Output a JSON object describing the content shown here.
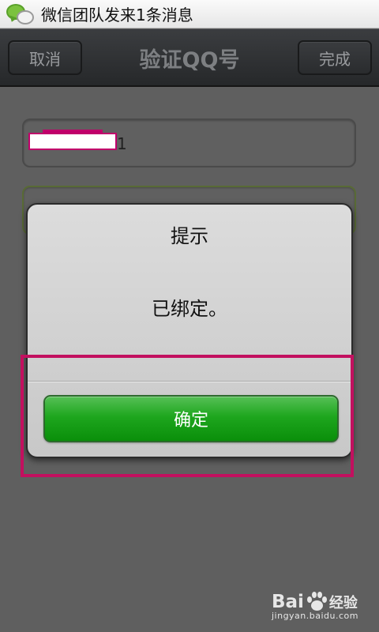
{
  "status_bar": {
    "notification_text": "微信团队发来1条消息",
    "app_icon": "wechat-icon"
  },
  "title_bar": {
    "cancel_label": "取消",
    "title": "验证QQ号",
    "done_label": "完成"
  },
  "form": {
    "qq_field_visible_value": "1",
    "qq_field_redacted": true
  },
  "dialog": {
    "title": "提示",
    "message": "已绑定。",
    "confirm_label": "确定"
  },
  "annotation": {
    "highlight_color": "#c2105f"
  },
  "watermark": {
    "brand": "Bai",
    "brand_suffix": "经验",
    "url": "jingyan.baidu.com",
    "icon": "paw-icon"
  },
  "colors": {
    "confirm_green": "#1ea61e",
    "titlebar_dark": "#2e3033"
  }
}
